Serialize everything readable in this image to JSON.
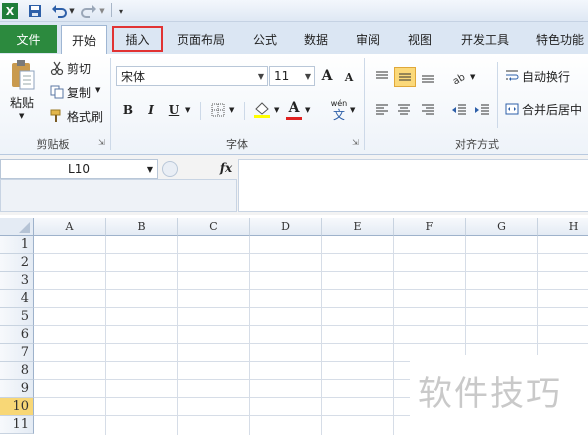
{
  "tabs": {
    "file": "文件",
    "home": "开始",
    "insert": "插入",
    "page_layout": "页面布局",
    "formulas": "公式",
    "data": "数据",
    "review": "审阅",
    "view": "视图",
    "developer": "开发工具",
    "special": "特色功能"
  },
  "clipboard": {
    "paste": "粘贴",
    "cut": "剪切",
    "copy": "复制",
    "format_painter": "格式刷",
    "group": "剪贴板"
  },
  "font": {
    "name": "宋体",
    "size": "11",
    "bold": "B",
    "italic": "I",
    "underline": "U",
    "grow": "A",
    "shrink": "A",
    "font_color_glyph": "A",
    "phonetic_top": "wén",
    "phonetic_glyph": "文",
    "group": "字体"
  },
  "alignment": {
    "wrap_text": "自动换行",
    "merge_center": "合并后居中",
    "group": "对齐方式"
  },
  "formula_bar": {
    "name_box": "L10",
    "fx": "fx"
  },
  "sheet": {
    "columns": [
      "A",
      "B",
      "C",
      "D",
      "E",
      "F",
      "G",
      "H"
    ],
    "rows": [
      "1",
      "2",
      "3",
      "4",
      "5",
      "6",
      "7",
      "8",
      "9",
      "10",
      "11"
    ],
    "selected_row": "10"
  },
  "watermark": "软件技巧",
  "colors": {
    "file_tab": "#2c8a3e",
    "highlight_border": "#e13333",
    "selected_row_header": "#f8d776",
    "fill_color": "#ffff00",
    "font_color": "#e02020"
  }
}
